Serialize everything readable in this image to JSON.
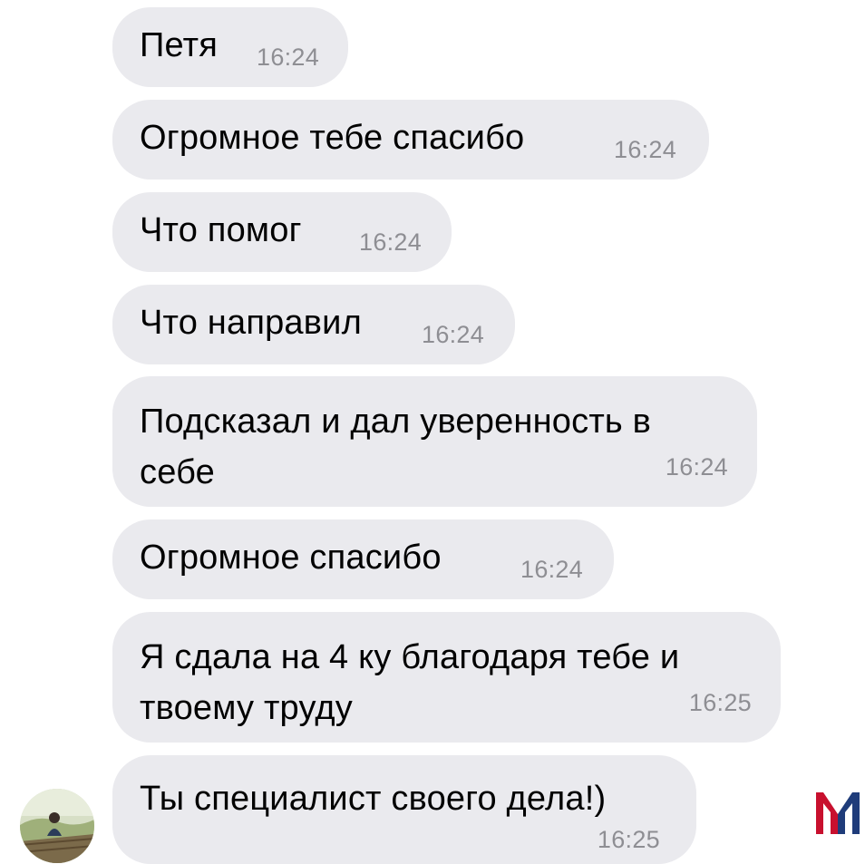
{
  "messages": [
    {
      "text": "Петя",
      "time": "16:24"
    },
    {
      "text": "Огромное тебе спасибо",
      "time": "16:24"
    },
    {
      "text": "Что помог",
      "time": "16:24"
    },
    {
      "text": "Что направил",
      "time": "16:24"
    },
    {
      "text_line1": "Подсказал и дал уверенность в",
      "text_line2": "себе",
      "time": "16:24"
    },
    {
      "text": "Огромное спасибо",
      "time": "16:24"
    },
    {
      "text_line1": "Я сдала на 4 ку благодаря тебе и",
      "text_line2": "твоему труду",
      "time": "16:25"
    },
    {
      "text": "Ты специалист своего дела!)",
      "time": "16:25"
    }
  ],
  "colors": {
    "bubble_bg": "#eaeaee",
    "time_text": "#8e8e93",
    "logo_red": "#c8102e",
    "logo_blue": "#1f3c7a"
  },
  "icons": {
    "avatar": "contact-avatar",
    "watermark": "m-logo-icon"
  }
}
